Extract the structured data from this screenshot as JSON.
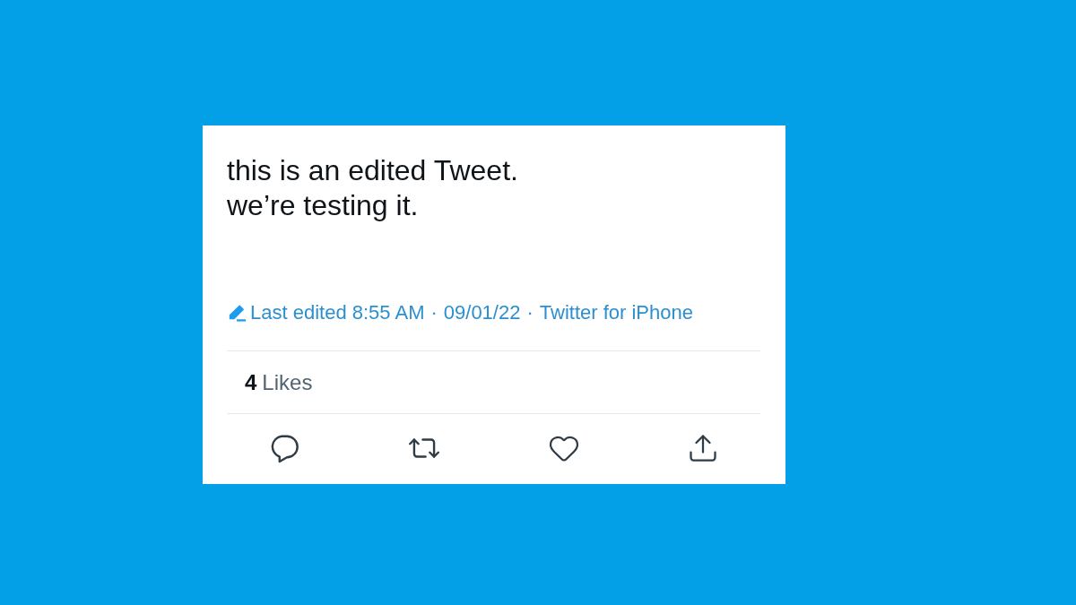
{
  "tweet": {
    "text": "this is an edited Tweet.\nwe’re testing it.",
    "meta": [
      {
        "kind": "edited",
        "text": "Last edited 8:55 AM"
      },
      {
        "kind": "separator",
        "text": "·"
      },
      {
        "kind": "date",
        "text": "09/01/22"
      },
      {
        "kind": "separator",
        "text": "·"
      },
      {
        "kind": "source",
        "text": "Twitter for iPhone"
      }
    ],
    "likes": {
      "count": "4",
      "label": "Likes"
    }
  }
}
